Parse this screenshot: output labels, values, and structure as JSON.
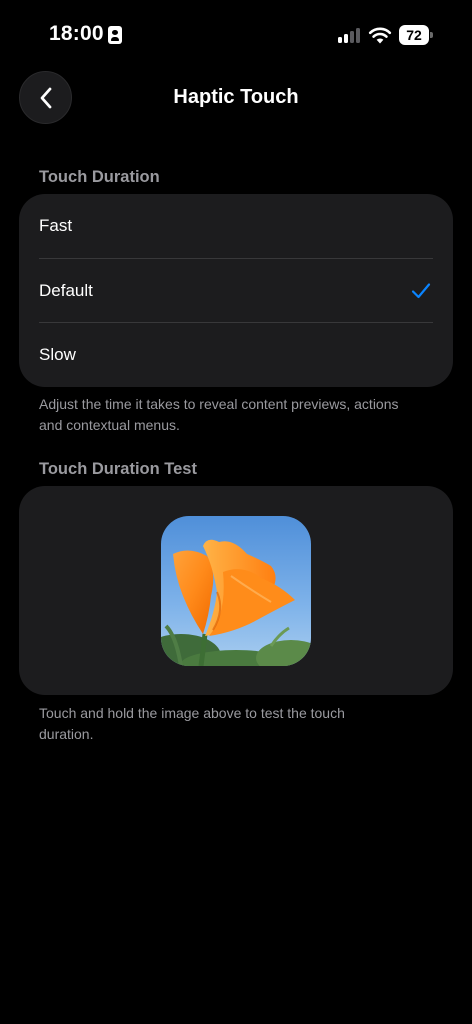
{
  "status_bar": {
    "time": "18:00",
    "battery_level": "72",
    "signal_bars_active": 2,
    "signal_bars_total": 4
  },
  "nav": {
    "title": "Haptic Touch",
    "back_icon": "chevron-left-icon"
  },
  "touch_duration": {
    "header": "Touch Duration",
    "options": [
      {
        "label": "Fast",
        "selected": false
      },
      {
        "label": "Default",
        "selected": true
      },
      {
        "label": "Slow",
        "selected": false
      }
    ],
    "footer": "Adjust the time it takes to reveal content previews, actions and contextual menus."
  },
  "touch_test": {
    "header": "Touch Duration Test",
    "image_subject": "orange-poppy-flower",
    "footer": "Touch and hold the image above to test the touch duration."
  },
  "colors": {
    "background": "#000000",
    "group_background": "#1c1c1e",
    "accent": "#0a84ff",
    "secondary_text": "#9a9a9f"
  }
}
